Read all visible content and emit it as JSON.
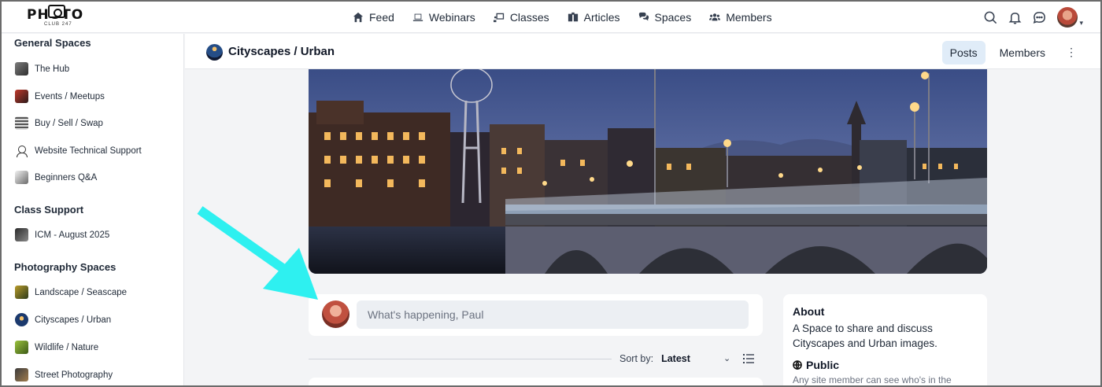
{
  "brand": {
    "logo_text": "PHOTO",
    "logo_sub": "CLUB 247"
  },
  "nav": {
    "items": [
      {
        "label": "Feed",
        "icon": "home-icon"
      },
      {
        "label": "Webinars",
        "icon": "laptop-icon"
      },
      {
        "label": "Classes",
        "icon": "presentation-icon"
      },
      {
        "label": "Articles",
        "icon": "book-icon"
      },
      {
        "label": "Spaces",
        "icon": "chat-bubbles-icon"
      },
      {
        "label": "Members",
        "icon": "users-icon"
      }
    ],
    "right_icons": [
      "search-icon",
      "bell-icon",
      "message-icon",
      "avatar"
    ]
  },
  "sidebar": {
    "sections": [
      {
        "title": "General Spaces",
        "items": [
          {
            "label": "The Hub"
          },
          {
            "label": "Events / Meetups"
          },
          {
            "label": "Buy / Sell / Swap"
          },
          {
            "label": "Website Technical Support"
          },
          {
            "label": "Beginners Q&A"
          }
        ]
      },
      {
        "title": "Class Support",
        "items": [
          {
            "label": "ICM - August 2025"
          }
        ]
      },
      {
        "title": "Photography Spaces",
        "items": [
          {
            "label": "Landscape / Seascape"
          },
          {
            "label": "Cityscapes / Urban"
          },
          {
            "label": "Wildlife / Nature"
          },
          {
            "label": "Street Photography"
          }
        ]
      }
    ]
  },
  "space": {
    "title": "Cityscapes / Urban",
    "tabs": [
      {
        "label": "Posts",
        "active": true
      },
      {
        "label": "Members",
        "active": false
      }
    ],
    "more_label": "⋮"
  },
  "composer": {
    "placeholder": "What's happening, Paul"
  },
  "about": {
    "title": "About",
    "description": "A Space to share and discuss Cityscapes and Urban images.",
    "visibility": "Public",
    "visibility_note": "Any site member can see who's in the"
  },
  "sort": {
    "label": "Sort by:",
    "value": "Latest"
  },
  "colors": {
    "accent_tab_bg": "#e0ecf8",
    "annotation_arrow": "#2ef0f0",
    "page_bg": "#f3f4f6"
  }
}
